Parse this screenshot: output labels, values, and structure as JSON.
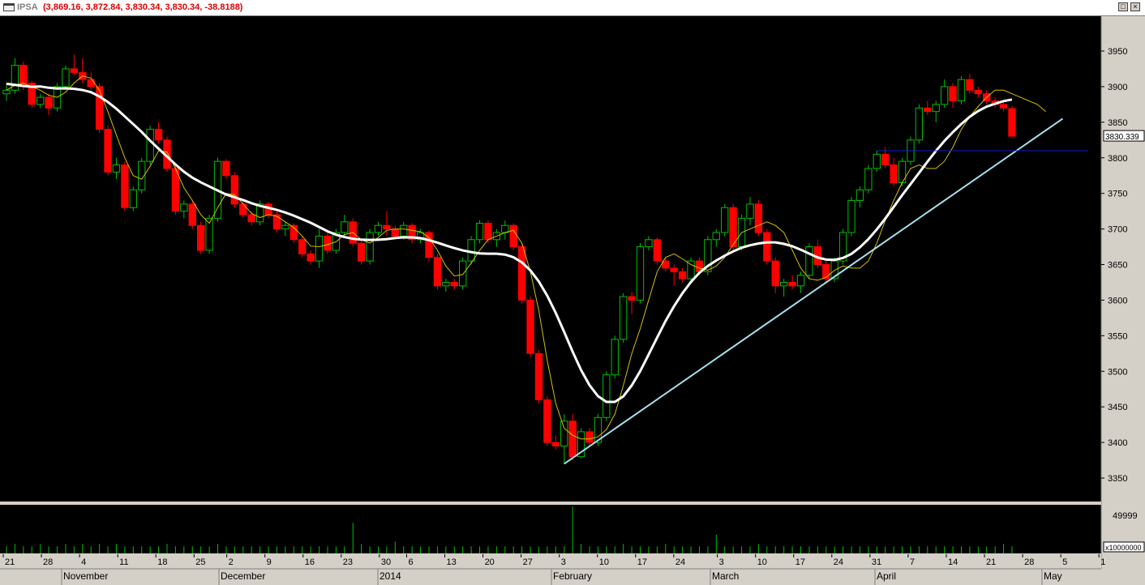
{
  "window": {
    "symbol": "IPSA",
    "quote": "(3,869.16, 3,872.84, 3,830.34, 3,830.34, -38.8188)",
    "restore_icon": "restore-icon",
    "close_icon": "close-icon"
  },
  "chart_data": {
    "type": "candlestick",
    "symbol": "IPSA",
    "y_ticks": [
      "3950",
      "3900",
      "3850",
      "3800",
      "3750",
      "3700",
      "3650",
      "3600",
      "3550",
      "3500",
      "3450",
      "3400",
      "3350"
    ],
    "ylim": [
      3320,
      4000
    ],
    "last_price_label": "3830.339",
    "volume_ticks": [
      "49999"
    ],
    "volume_unit": "x10000000",
    "x_day_labels": [
      "21",
      "28",
      "4",
      "11",
      "18",
      "25",
      "2",
      "9",
      "16",
      "23",
      "30",
      "6",
      "13",
      "20",
      "27",
      "3",
      "10",
      "17",
      "24",
      "3",
      "10",
      "17",
      "24",
      "31",
      "7",
      "14",
      "21",
      "28",
      "5",
      "1"
    ],
    "x_month_labels": [
      "November",
      "December",
      "2014",
      "February",
      "March",
      "April",
      "May"
    ],
    "colors": {
      "background": "#000000",
      "up": "#00c000",
      "down": "#ff0000",
      "ma_fast": "#d4c000",
      "ma_slow": "#ffffff",
      "trendline": "#a8e0f0",
      "resistance": "#1020d0",
      "volume": "#00c000"
    },
    "candles": [
      {
        "o": 3890,
        "h": 3905,
        "l": 3880,
        "c": 3895
      },
      {
        "o": 3895,
        "h": 3940,
        "l": 3890,
        "c": 3930
      },
      {
        "o": 3930,
        "h": 3935,
        "l": 3895,
        "c": 3900
      },
      {
        "o": 3905,
        "h": 3908,
        "l": 3870,
        "c": 3875
      },
      {
        "o": 3875,
        "h": 3890,
        "l": 3870,
        "c": 3885
      },
      {
        "o": 3885,
        "h": 3890,
        "l": 3860,
        "c": 3870
      },
      {
        "o": 3870,
        "h": 3905,
        "l": 3865,
        "c": 3900
      },
      {
        "o": 3900,
        "h": 3930,
        "l": 3895,
        "c": 3925
      },
      {
        "o": 3925,
        "h": 3945,
        "l": 3915,
        "c": 3920
      },
      {
        "o": 3920,
        "h": 3940,
        "l": 3905,
        "c": 3910
      },
      {
        "o": 3910,
        "h": 3920,
        "l": 3895,
        "c": 3900
      },
      {
        "o": 3900,
        "h": 3905,
        "l": 3835,
        "c": 3840
      },
      {
        "o": 3840,
        "h": 3845,
        "l": 3775,
        "c": 3780
      },
      {
        "o": 3780,
        "h": 3800,
        "l": 3770,
        "c": 3790
      },
      {
        "o": 3790,
        "h": 3795,
        "l": 3725,
        "c": 3730
      },
      {
        "o": 3730,
        "h": 3760,
        "l": 3725,
        "c": 3755
      },
      {
        "o": 3755,
        "h": 3800,
        "l": 3750,
        "c": 3795
      },
      {
        "o": 3795,
        "h": 3845,
        "l": 3790,
        "c": 3840
      },
      {
        "o": 3840,
        "h": 3850,
        "l": 3820,
        "c": 3825
      },
      {
        "o": 3825,
        "h": 3830,
        "l": 3780,
        "c": 3785
      },
      {
        "o": 3785,
        "h": 3790,
        "l": 3720,
        "c": 3725
      },
      {
        "o": 3725,
        "h": 3740,
        "l": 3715,
        "c": 3735
      },
      {
        "o": 3735,
        "h": 3740,
        "l": 3700,
        "c": 3705
      },
      {
        "o": 3705,
        "h": 3710,
        "l": 3665,
        "c": 3670
      },
      {
        "o": 3670,
        "h": 3720,
        "l": 3665,
        "c": 3715
      },
      {
        "o": 3715,
        "h": 3800,
        "l": 3710,
        "c": 3795
      },
      {
        "o": 3795,
        "h": 3798,
        "l": 3770,
        "c": 3775
      },
      {
        "o": 3775,
        "h": 3780,
        "l": 3730,
        "c": 3735
      },
      {
        "o": 3735,
        "h": 3740,
        "l": 3715,
        "c": 3720
      },
      {
        "o": 3720,
        "h": 3725,
        "l": 3705,
        "c": 3710
      },
      {
        "o": 3710,
        "h": 3740,
        "l": 3705,
        "c": 3735
      },
      {
        "o": 3735,
        "h": 3738,
        "l": 3715,
        "c": 3720
      },
      {
        "o": 3720,
        "h": 3725,
        "l": 3695,
        "c": 3700
      },
      {
        "o": 3700,
        "h": 3710,
        "l": 3690,
        "c": 3705
      },
      {
        "o": 3705,
        "h": 3708,
        "l": 3680,
        "c": 3685
      },
      {
        "o": 3685,
        "h": 3690,
        "l": 3660,
        "c": 3665
      },
      {
        "o": 3665,
        "h": 3670,
        "l": 3650,
        "c": 3655
      },
      {
        "o": 3655,
        "h": 3700,
        "l": 3645,
        "c": 3690
      },
      {
        "o": 3690,
        "h": 3695,
        "l": 3665,
        "c": 3670
      },
      {
        "o": 3670,
        "h": 3700,
        "l": 3665,
        "c": 3695
      },
      {
        "o": 3695,
        "h": 3720,
        "l": 3690,
        "c": 3710
      },
      {
        "o": 3710,
        "h": 3715,
        "l": 3675,
        "c": 3680
      },
      {
        "o": 3680,
        "h": 3685,
        "l": 3650,
        "c": 3655
      },
      {
        "o": 3655,
        "h": 3700,
        "l": 3650,
        "c": 3695
      },
      {
        "o": 3695,
        "h": 3710,
        "l": 3690,
        "c": 3705
      },
      {
        "o": 3705,
        "h": 3725,
        "l": 3690,
        "c": 3700
      },
      {
        "o": 3700,
        "h": 3705,
        "l": 3685,
        "c": 3690
      },
      {
        "o": 3690,
        "h": 3710,
        "l": 3685,
        "c": 3705
      },
      {
        "o": 3705,
        "h": 3708,
        "l": 3680,
        "c": 3685
      },
      {
        "o": 3685,
        "h": 3700,
        "l": 3680,
        "c": 3695
      },
      {
        "o": 3695,
        "h": 3698,
        "l": 3655,
        "c": 3660
      },
      {
        "o": 3660,
        "h": 3665,
        "l": 3615,
        "c": 3620
      },
      {
        "o": 3620,
        "h": 3630,
        "l": 3612,
        "c": 3625
      },
      {
        "o": 3625,
        "h": 3630,
        "l": 3615,
        "c": 3620
      },
      {
        "o": 3620,
        "h": 3660,
        "l": 3615,
        "c": 3655
      },
      {
        "o": 3655,
        "h": 3690,
        "l": 3650,
        "c": 3685
      },
      {
        "o": 3685,
        "h": 3712,
        "l": 3680,
        "c": 3708
      },
      {
        "o": 3708,
        "h": 3712,
        "l": 3680,
        "c": 3685
      },
      {
        "o": 3685,
        "h": 3700,
        "l": 3675,
        "c": 3695
      },
      {
        "o": 3695,
        "h": 3712,
        "l": 3685,
        "c": 3705
      },
      {
        "o": 3705,
        "h": 3708,
        "l": 3670,
        "c": 3675
      },
      {
        "o": 3675,
        "h": 3680,
        "l": 3595,
        "c": 3600
      },
      {
        "o": 3600,
        "h": 3605,
        "l": 3520,
        "c": 3525
      },
      {
        "o": 3525,
        "h": 3530,
        "l": 3455,
        "c": 3460
      },
      {
        "o": 3460,
        "h": 3465,
        "l": 3395,
        "c": 3400
      },
      {
        "o": 3400,
        "h": 3410,
        "l": 3390,
        "c": 3395
      },
      {
        "o": 3395,
        "h": 3440,
        "l": 3370,
        "c": 3430
      },
      {
        "o": 3430,
        "h": 3440,
        "l": 3375,
        "c": 3380
      },
      {
        "o": 3380,
        "h": 3420,
        "l": 3378,
        "c": 3415
      },
      {
        "o": 3415,
        "h": 3420,
        "l": 3395,
        "c": 3400
      },
      {
        "o": 3400,
        "h": 3440,
        "l": 3395,
        "c": 3435
      },
      {
        "o": 3435,
        "h": 3500,
        "l": 3430,
        "c": 3495
      },
      {
        "o": 3495,
        "h": 3550,
        "l": 3490,
        "c": 3545
      },
      {
        "o": 3545,
        "h": 3610,
        "l": 3540,
        "c": 3605
      },
      {
        "o": 3605,
        "h": 3612,
        "l": 3580,
        "c": 3600
      },
      {
        "o": 3600,
        "h": 3680,
        "l": 3595,
        "c": 3675
      },
      {
        "o": 3675,
        "h": 3690,
        "l": 3670,
        "c": 3685
      },
      {
        "o": 3685,
        "h": 3688,
        "l": 3650,
        "c": 3655
      },
      {
        "o": 3655,
        "h": 3660,
        "l": 3640,
        "c": 3645
      },
      {
        "o": 3645,
        "h": 3650,
        "l": 3620,
        "c": 3640
      },
      {
        "o": 3640,
        "h": 3645,
        "l": 3625,
        "c": 3630
      },
      {
        "o": 3630,
        "h": 3660,
        "l": 3625,
        "c": 3655
      },
      {
        "o": 3655,
        "h": 3660,
        "l": 3635,
        "c": 3640
      },
      {
        "o": 3640,
        "h": 3690,
        "l": 3635,
        "c": 3685
      },
      {
        "o": 3685,
        "h": 3700,
        "l": 3675,
        "c": 3695
      },
      {
        "o": 3695,
        "h": 3735,
        "l": 3690,
        "c": 3730
      },
      {
        "o": 3730,
        "h": 3735,
        "l": 3670,
        "c": 3675
      },
      {
        "o": 3675,
        "h": 3720,
        "l": 3670,
        "c": 3715
      },
      {
        "o": 3715,
        "h": 3745,
        "l": 3705,
        "c": 3735
      },
      {
        "o": 3735,
        "h": 3740,
        "l": 3690,
        "c": 3695
      },
      {
        "o": 3695,
        "h": 3700,
        "l": 3650,
        "c": 3655
      },
      {
        "o": 3655,
        "h": 3660,
        "l": 3610,
        "c": 3620
      },
      {
        "o": 3620,
        "h": 3630,
        "l": 3605,
        "c": 3625
      },
      {
        "o": 3625,
        "h": 3635,
        "l": 3615,
        "c": 3620
      },
      {
        "o": 3620,
        "h": 3640,
        "l": 3610,
        "c": 3635
      },
      {
        "o": 3635,
        "h": 3680,
        "l": 3630,
        "c": 3675
      },
      {
        "o": 3675,
        "h": 3685,
        "l": 3645,
        "c": 3650
      },
      {
        "o": 3650,
        "h": 3655,
        "l": 3625,
        "c": 3630
      },
      {
        "o": 3630,
        "h": 3660,
        "l": 3625,
        "c": 3655
      },
      {
        "o": 3655,
        "h": 3700,
        "l": 3650,
        "c": 3695
      },
      {
        "o": 3695,
        "h": 3745,
        "l": 3690,
        "c": 3740
      },
      {
        "o": 3740,
        "h": 3760,
        "l": 3730,
        "c": 3755
      },
      {
        "o": 3755,
        "h": 3790,
        "l": 3750,
        "c": 3785
      },
      {
        "o": 3785,
        "h": 3810,
        "l": 3780,
        "c": 3805
      },
      {
        "o": 3805,
        "h": 3815,
        "l": 3785,
        "c": 3790
      },
      {
        "o": 3790,
        "h": 3800,
        "l": 3760,
        "c": 3765
      },
      {
        "o": 3765,
        "h": 3800,
        "l": 3760,
        "c": 3795
      },
      {
        "o": 3795,
        "h": 3830,
        "l": 3790,
        "c": 3825
      },
      {
        "o": 3825,
        "h": 3875,
        "l": 3820,
        "c": 3870
      },
      {
        "o": 3870,
        "h": 3880,
        "l": 3860,
        "c": 3865
      },
      {
        "o": 3865,
        "h": 3880,
        "l": 3850,
        "c": 3875
      },
      {
        "o": 3875,
        "h": 3910,
        "l": 3870,
        "c": 3900
      },
      {
        "o": 3900,
        "h": 3905,
        "l": 3870,
        "c": 3880
      },
      {
        "o": 3880,
        "h": 3915,
        "l": 3875,
        "c": 3910
      },
      {
        "o": 3910,
        "h": 3918,
        "l": 3890,
        "c": 3895
      },
      {
        "o": 3895,
        "h": 3900,
        "l": 3885,
        "c": 3890
      },
      {
        "o": 3890,
        "h": 3895,
        "l": 3875,
        "c": 3880
      },
      {
        "o": 3880,
        "h": 3885,
        "l": 3870,
        "c": 3875
      },
      {
        "o": 3875,
        "h": 3880,
        "l": 3865,
        "c": 3870
      },
      {
        "o": 3869.16,
        "h": 3872.84,
        "l": 3830.34,
        "c": 3830.34
      }
    ],
    "volumes": [
      3,
      4,
      3,
      3,
      4,
      3,
      3,
      4,
      3,
      4,
      3,
      4,
      3,
      4,
      3,
      3,
      3,
      3,
      3,
      4,
      3,
      3,
      3,
      3,
      3,
      4,
      3,
      3,
      3,
      3,
      3,
      3,
      3,
      3,
      3,
      3,
      3,
      3,
      3,
      3,
      3,
      13,
      4,
      3,
      3,
      3,
      5,
      3,
      3,
      3,
      3,
      3,
      3,
      3,
      3,
      3,
      3,
      3,
      3,
      3,
      3,
      3,
      3,
      3,
      3,
      3,
      3,
      20,
      4,
      3,
      3,
      3,
      3,
      4,
      3,
      3,
      3,
      3,
      4,
      3,
      3,
      3,
      3,
      3,
      8,
      3,
      3,
      3,
      3,
      4,
      3,
      3,
      3,
      3,
      3,
      3,
      3,
      3,
      3,
      3,
      3,
      3,
      3,
      3,
      3,
      3,
      3,
      3,
      3,
      3,
      3,
      3,
      3,
      3,
      3,
      3,
      3,
      3,
      4,
      3,
      3,
      3,
      3
    ],
    "ma_fast": [
      3895,
      3902,
      3905,
      3900,
      3895,
      3888,
      3885,
      3892,
      3905,
      3915,
      3912,
      3895,
      3865,
      3832,
      3800,
      3775,
      3770,
      3788,
      3810,
      3808,
      3785,
      3758,
      3740,
      3720,
      3708,
      3730,
      3750,
      3748,
      3735,
      3722,
      3716,
      3720,
      3718,
      3710,
      3702,
      3690,
      3676,
      3675,
      3678,
      3682,
      3692,
      3695,
      3685,
      3680,
      3688,
      3698,
      3700,
      3700,
      3698,
      3696,
      3688,
      3670,
      3648,
      3634,
      3636,
      3652,
      3670,
      3685,
      3690,
      3695,
      3698,
      3680,
      3640,
      3585,
      3515,
      3455,
      3420,
      3410,
      3405,
      3405,
      3408,
      3418,
      3440,
      3480,
      3525,
      3560,
      3600,
      3640,
      3660,
      3665,
      3658,
      3650,
      3645,
      3642,
      3648,
      3660,
      3678,
      3695,
      3700,
      3705,
      3710,
      3705,
      3695,
      3670,
      3645,
      3630,
      3628,
      3632,
      3642,
      3648,
      3645,
      3645,
      3655,
      3680,
      3712,
      3740,
      3765,
      3785,
      3790,
      3785,
      3785,
      3795,
      3815,
      3840,
      3858,
      3872,
      3885,
      3895,
      3895,
      3890,
      3885,
      3880,
      3875,
      3865
    ]
  }
}
